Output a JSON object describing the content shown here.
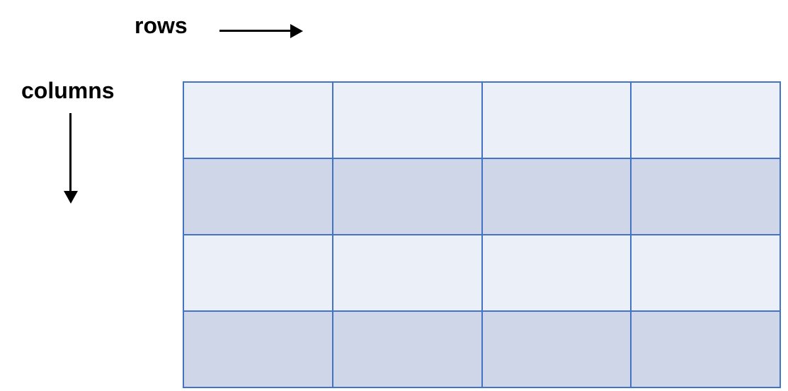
{
  "labels": {
    "rows": "rows",
    "columns": "columns"
  },
  "grid": {
    "num_rows": 4,
    "num_cols": 4,
    "row_shades": [
      "light",
      "dark",
      "light",
      "dark"
    ]
  },
  "colors": {
    "border": "#4472c4",
    "light_fill": "#ebeff8",
    "dark_fill": "#ced6e8"
  }
}
